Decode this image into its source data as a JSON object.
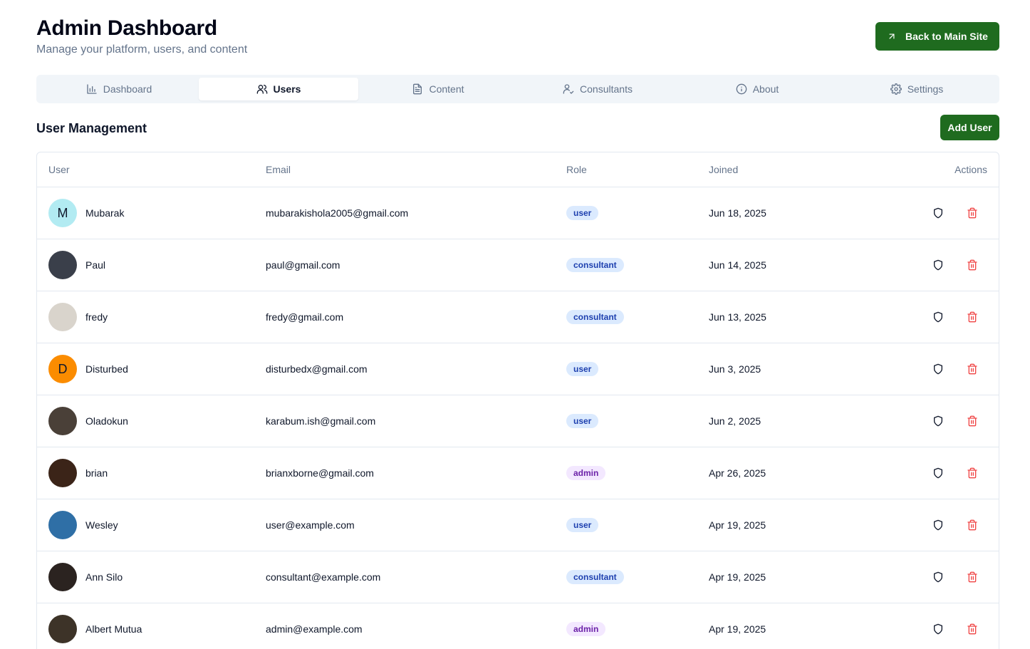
{
  "header": {
    "title": "Admin Dashboard",
    "subtitle": "Manage your platform, users, and content",
    "back_label": "Back to Main Site"
  },
  "tabs": [
    {
      "label": "Dashboard",
      "icon": "bar-chart-icon",
      "active": false
    },
    {
      "label": "Users",
      "icon": "users-icon",
      "active": true
    },
    {
      "label": "Content",
      "icon": "file-text-icon",
      "active": false
    },
    {
      "label": "Consultants",
      "icon": "user-check-icon",
      "active": false
    },
    {
      "label": "About",
      "icon": "info-icon",
      "active": false
    },
    {
      "label": "Settings",
      "icon": "gear-icon",
      "active": false
    }
  ],
  "section": {
    "title": "User Management",
    "add_label": "Add User"
  },
  "table": {
    "columns": [
      "User",
      "Email",
      "Role",
      "Joined",
      "Actions"
    ],
    "rows": [
      {
        "name": "Mubarak",
        "email": "mubarakishola2005@gmail.com",
        "role": "user",
        "joined": "Jun 18, 2025",
        "initial": "M",
        "avatar_color": "#b2ebf2"
      },
      {
        "name": "Paul",
        "email": "paul@gmail.com",
        "role": "consultant",
        "joined": "Jun 14, 2025",
        "initial": "",
        "avatar_color": "#3a3f4a"
      },
      {
        "name": "fredy",
        "email": "fredy@gmail.com",
        "role": "consultant",
        "joined": "Jun 13, 2025",
        "initial": "",
        "avatar_color": "#d9d4cc"
      },
      {
        "name": "Disturbed",
        "email": "disturbedx@gmail.com",
        "role": "user",
        "joined": "Jun 3, 2025",
        "initial": "D",
        "avatar_color": "#fb8c00"
      },
      {
        "name": "Oladokun",
        "email": "karabum.ish@gmail.com",
        "role": "user",
        "joined": "Jun 2, 2025",
        "initial": "",
        "avatar_color": "#4a4038"
      },
      {
        "name": "brian",
        "email": "brianxborne@gmail.com",
        "role": "admin",
        "joined": "Apr 26, 2025",
        "initial": "",
        "avatar_color": "#3b2418"
      },
      {
        "name": "Wesley",
        "email": "user@example.com",
        "role": "user",
        "joined": "Apr 19, 2025",
        "initial": "",
        "avatar_color": "#2f6fa6"
      },
      {
        "name": "Ann Silo",
        "email": "consultant@example.com",
        "role": "consultant",
        "joined": "Apr 19, 2025",
        "initial": "",
        "avatar_color": "#2b2320"
      },
      {
        "name": "Albert Mutua",
        "email": "admin@example.com",
        "role": "admin",
        "joined": "Apr 19, 2025",
        "initial": "",
        "avatar_color": "#3d3328"
      }
    ]
  },
  "colors": {
    "primary_green": "#1f6b1f",
    "delete_red": "#ef4444"
  }
}
